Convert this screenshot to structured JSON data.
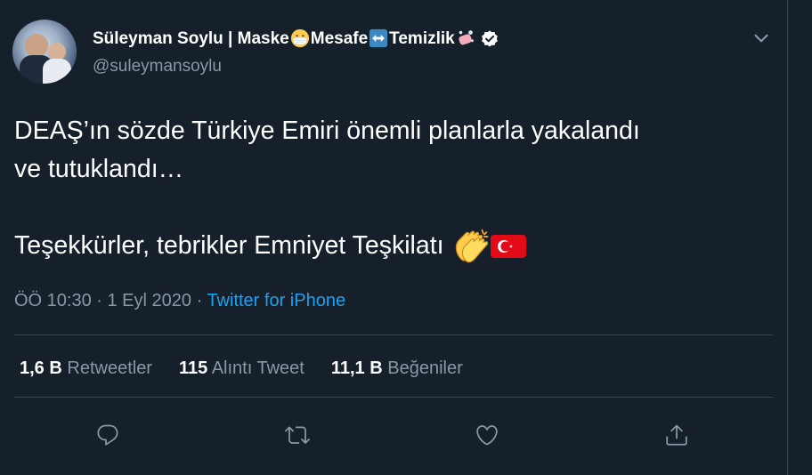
{
  "user": {
    "display_name_part1": "Süleyman Soylu | Maske",
    "display_name_part2": " Mesafe",
    "display_name_part3": " Temizlik",
    "handle": "@suleymansoylu"
  },
  "tweet": {
    "line1": "DEAŞ’ın sözde Türkiye Emiri önemli planlarla yakalandı",
    "line2": "ve tutuklandı…",
    "line3": "Teşekkürler, tebrikler Emniyet Teşkilatı "
  },
  "meta": {
    "time": "ÖÖ 10:30",
    "dot1": " · ",
    "date": "1 Eyl 2020",
    "dot2": " · ",
    "source": "Twitter for iPhone"
  },
  "stats": [
    {
      "value": "1,6 B",
      "label": "Retweetler"
    },
    {
      "value": "115",
      "label": "Alıntı Tweet"
    },
    {
      "value": "11,1 B",
      "label": "Beğeniler"
    }
  ],
  "icons": {
    "mask": "mask-face-emoji",
    "arrows": "left-right-arrow-emoji",
    "soap": "soap-bubbles-emoji",
    "verified": "verified-badge",
    "clap": "clapping-hands-emoji",
    "flag": "turkey-flag-emoji"
  },
  "colors": {
    "background": "#15202b",
    "text": "#ffffff",
    "secondary": "#8899a6",
    "link": "#1da1f2",
    "border": "#38444d"
  }
}
